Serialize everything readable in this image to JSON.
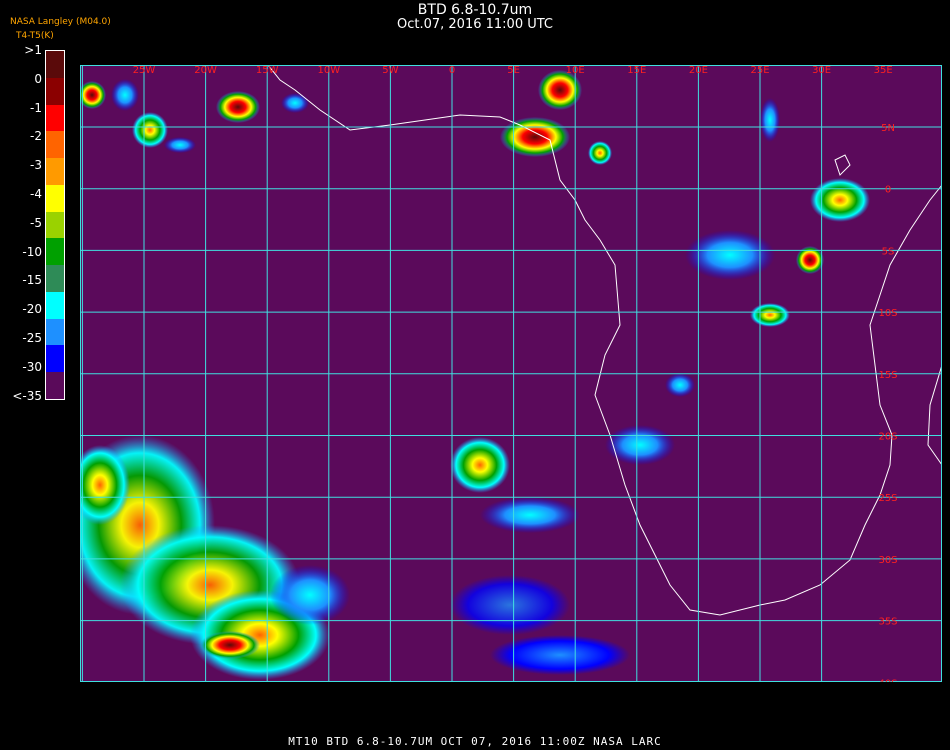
{
  "header": {
    "title": "BTD 6.8-10.7um",
    "subtitle": "Oct.07, 2016 11:00 UTC",
    "credit": "NASA Langley (M04.0)",
    "units": "T4-T5(K)"
  },
  "colorbar": {
    "labels": [
      ">1",
      "0",
      "-1",
      "-2",
      "-3",
      "-4",
      "-5",
      "-10",
      "-15",
      "-20",
      "-25",
      "-30",
      "<-35"
    ],
    "colors": [
      "#5a0a0a",
      "#8b0000",
      "#ff0000",
      "#ff6400",
      "#ff9a00",
      "#ffff00",
      "#9ad200",
      "#00a000",
      "#2e8b57",
      "#00ffff",
      "#1e90ff",
      "#0000ff",
      "#5a0a5a"
    ]
  },
  "map": {
    "background": "#5b0a5b",
    "grid_color": "#40e0e0",
    "coast_color": "#ffffff",
    "lon_labels": [
      "25W",
      "20W",
      "15W",
      "10W",
      "5W",
      "0",
      "5E",
      "10E",
      "15E",
      "20E",
      "25E",
      "30E",
      "35E"
    ],
    "lat_labels": [
      "5N",
      "0",
      "5S",
      "10S",
      "15S",
      "20S",
      "25S",
      "30S",
      "35S",
      "40S"
    ],
    "label_color": "#ff2020"
  },
  "footer": {
    "text": "MT10  BTD 6.8-10.7UM   OCT 07, 2016 11:00Z   NASA LARC"
  }
}
